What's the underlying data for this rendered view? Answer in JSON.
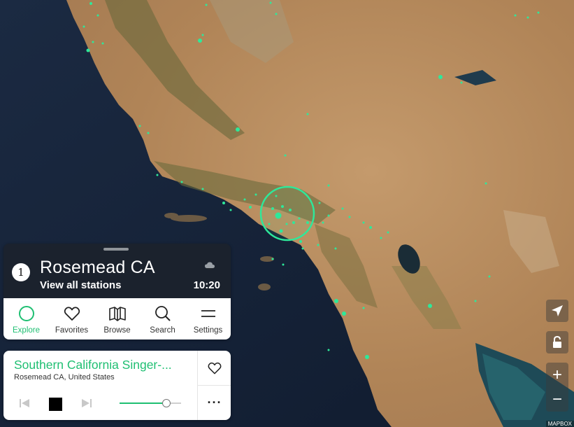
{
  "map": {
    "colors": {
      "ocean": "#17253d",
      "land": "#b68d60",
      "dots": "#2ee89a",
      "selection_ring": "#2ee89a"
    },
    "attribution": "MAPBOX"
  },
  "location_panel": {
    "badge": "1",
    "title": "Rosemead CA",
    "subtitle": "View all stations",
    "time": "10:20",
    "weather_icon": "cloud-icon"
  },
  "nav": {
    "items": [
      {
        "label": "Explore",
        "icon": "circle-icon",
        "active": true
      },
      {
        "label": "Favorites",
        "icon": "heart-icon",
        "active": false
      },
      {
        "label": "Browse",
        "icon": "map-book-icon",
        "active": false
      },
      {
        "label": "Search",
        "icon": "search-icon",
        "active": false
      },
      {
        "label": "Settings",
        "icon": "menu-lines-icon",
        "active": false
      }
    ],
    "accent": "#1fbf72"
  },
  "player": {
    "station_name": "Southern California Singer-...",
    "station_location": "Rosemead CA, United States",
    "volume": 0.76,
    "state": "playing",
    "more_label": "···"
  },
  "map_controls": {
    "locate_icon": "navigation-arrow-icon",
    "lock_icon": "unlock-icon",
    "zoom_in": "+",
    "zoom_out": "−"
  }
}
